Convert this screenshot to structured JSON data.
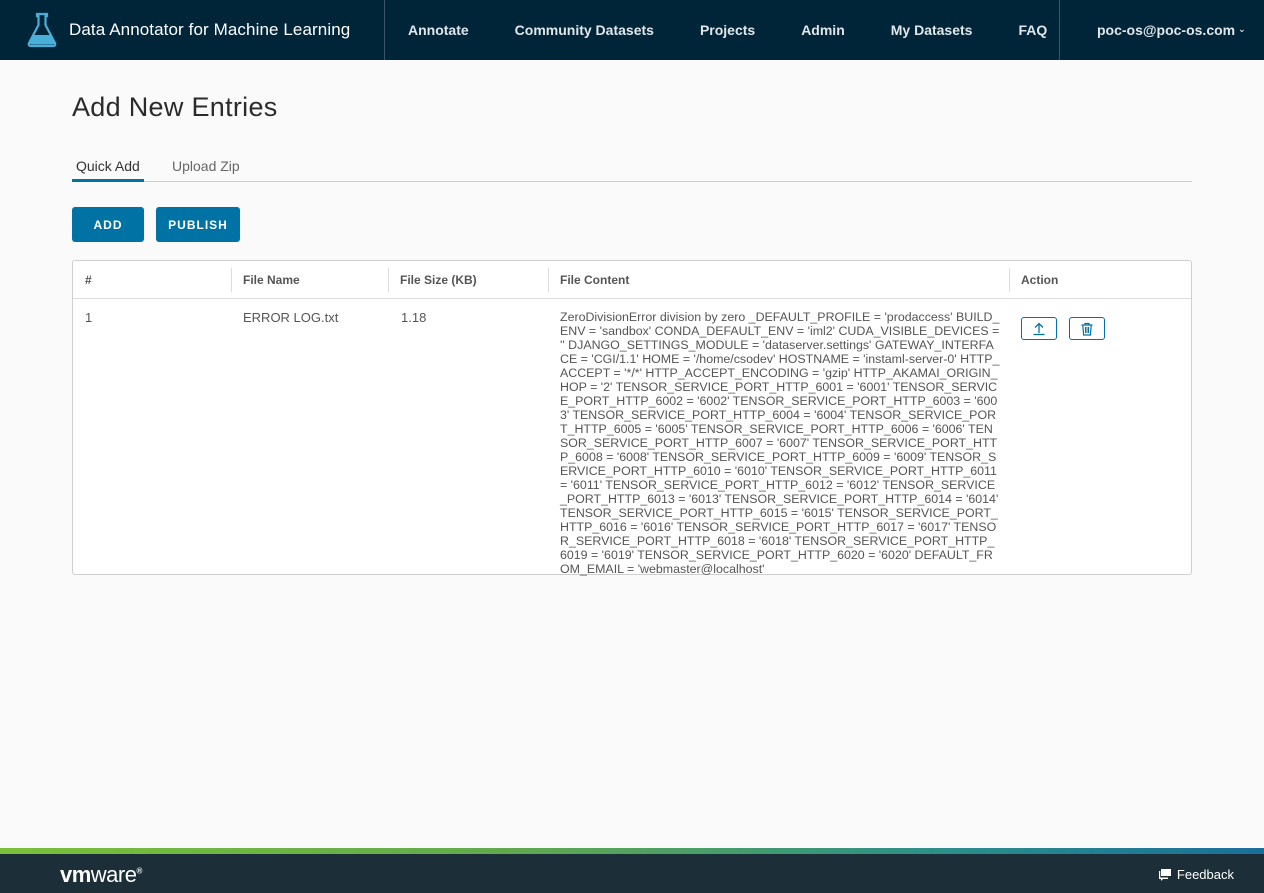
{
  "app": {
    "title": "Data Annotator for Machine Learning"
  },
  "nav": {
    "items": [
      {
        "label": "Annotate"
      },
      {
        "label": "Community Datasets"
      },
      {
        "label": "Projects"
      },
      {
        "label": "Admin"
      },
      {
        "label": "My Datasets"
      },
      {
        "label": "FAQ"
      }
    ],
    "user": "poc-os@poc-os.com"
  },
  "page": {
    "title": "Add New Entries",
    "tabs": [
      {
        "label": "Quick Add",
        "active": true
      },
      {
        "label": "Upload Zip",
        "active": false
      }
    ],
    "add_label": "ADD",
    "publish_label": "PUBLISH"
  },
  "table": {
    "columns": [
      "#",
      "File Name",
      "File Size (KB)",
      "File Content",
      "Action"
    ],
    "rows": [
      {
        "index": "1",
        "file_name": "ERROR LOG.txt",
        "file_size": "1.18",
        "content": "ZeroDivisionError division by zero _DEFAULT_PROFILE = 'prodaccess' BUILD_ENV = 'sandbox' CONDA_DEFAULT_ENV = 'iml2' CUDA_VISIBLE_DEVICES = '' DJANGO_SETTINGS_MODULE = 'dataserver.settings' GATEWAY_INTERFACE = 'CGI/1.1' HOME = '/home/csodev' HOSTNAME = 'instaml-server-0' HTTP_ACCEPT = '*/*' HTTP_ACCEPT_ENCODING = 'gzip' HTTP_AKAMAI_ORIGIN_HOP = '2' TENSOR_SERVICE_PORT_HTTP_6001 = '6001' TENSOR_SERVICE_PORT_HTTP_6002 = '6002' TENSOR_SERVICE_PORT_HTTP_6003 = '6003' TENSOR_SERVICE_PORT_HTTP_6004 = '6004' TENSOR_SERVICE_PORT_HTTP_6005 = '6005' TENSOR_SERVICE_PORT_HTTP_6006 = '6006' TENSOR_SERVICE_PORT_HTTP_6007 = '6007' TENSOR_SERVICE_PORT_HTTP_6008 = '6008' TENSOR_SERVICE_PORT_HTTP_6009 = '6009' TENSOR_SERVICE_PORT_HTTP_6010 = '6010' TENSOR_SERVICE_PORT_HTTP_6011 = '6011' TENSOR_SERVICE_PORT_HTTP_6012 = '6012' TENSOR_SERVICE_PORT_HTTP_6013 = '6013' TENSOR_SERVICE_PORT_HTTP_6014 = '6014' TENSOR_SERVICE_PORT_HTTP_6015 = '6015' TENSOR_SERVICE_PORT_HTTP_6016 = '6016' TENSOR_SERVICE_PORT_HTTP_6017 = '6017' TENSOR_SERVICE_PORT_HTTP_6018 = '6018' TENSOR_SERVICE_PORT_HTTP_6019 = '6019' TENSOR_SERVICE_PORT_HTTP_6020 = '6020' DEFAULT_FROM_EMAIL = 'webmaster@localhost'",
        "actions": [
          "upload-icon",
          "trash-icon"
        ]
      }
    ]
  },
  "footer": {
    "logo_text_bold": "vm",
    "logo_text_light": "ware",
    "logo_mark": "®",
    "feedback_label": "Feedback",
    "feedback_icon": "feedback-icon"
  },
  "colors": {
    "header_bg": "#002538",
    "primary": "#0072a3",
    "footer_bg": "#1c2e38"
  }
}
